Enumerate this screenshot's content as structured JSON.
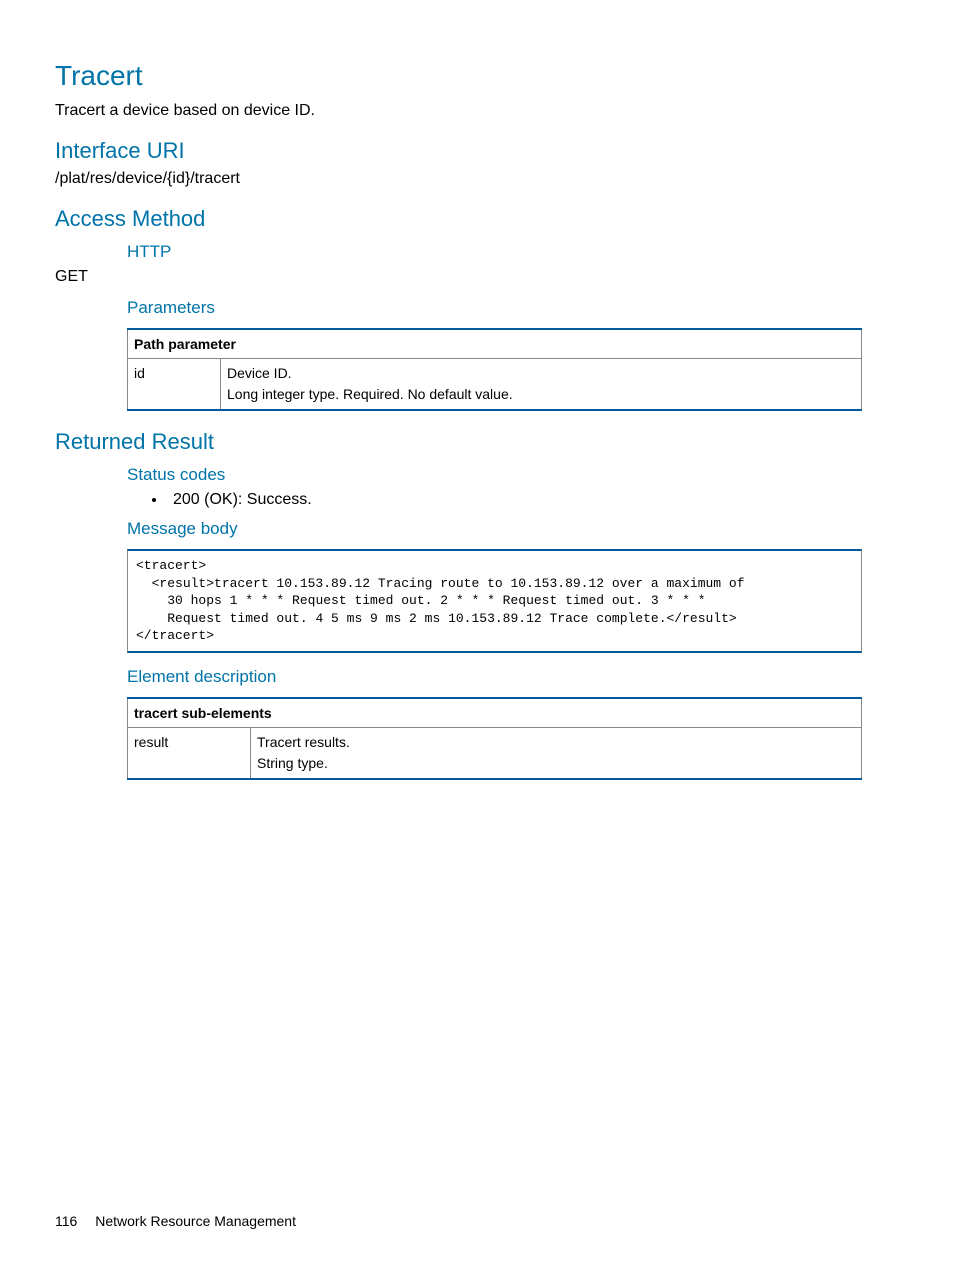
{
  "title": "Tracert",
  "intro": "Tracert a device based on device ID.",
  "sections": {
    "interface_uri": {
      "heading": "Interface URI",
      "value": "/plat/res/device/{id}/tracert"
    },
    "access_method": {
      "heading": "Access Method",
      "http_heading": "HTTP",
      "http_value": "GET",
      "params_heading": "Parameters",
      "params_table": {
        "header": "Path parameter",
        "rows": [
          {
            "name": "id",
            "desc": "Device ID.\nLong integer type. Required. No default value."
          }
        ]
      }
    },
    "returned_result": {
      "heading": "Returned Result",
      "status_heading": "Status codes",
      "status_items": [
        "200 (OK): Success."
      ],
      "body_heading": "Message body",
      "body_code": "<tracert>\n  <result>tracert 10.153.89.12 Tracing route to 10.153.89.12 over a maximum of \n    30 hops 1 * * * Request timed out. 2 * * * Request timed out. 3 * * * \n    Request timed out. 4 5 ms 9 ms 2 ms 10.153.89.12 Trace complete.</result>\n</tracert>",
      "element_heading": "Element description",
      "element_table": {
        "header": "tracert sub-elements",
        "rows": [
          {
            "name": "result",
            "desc": "Tracert results.\nString type."
          }
        ]
      }
    }
  },
  "footer": {
    "page_number": "116",
    "section": "Network Resource Management"
  }
}
